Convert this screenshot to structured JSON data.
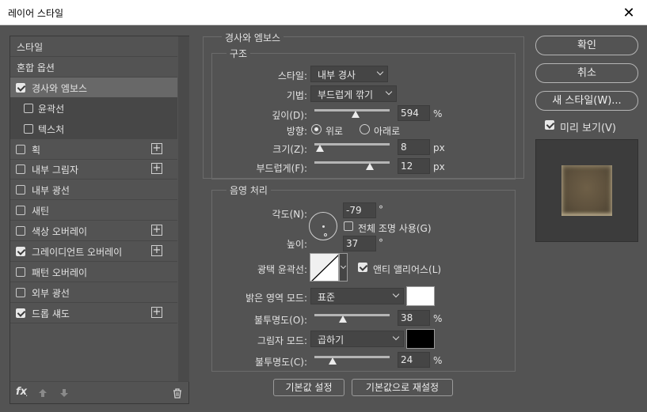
{
  "window": {
    "title": "레이어 스타일",
    "close_glyph": "✕"
  },
  "styles_list": [
    {
      "label": "스타일",
      "checkable": false,
      "checked": false,
      "plus": false,
      "state": "plain"
    },
    {
      "label": "혼합 옵션",
      "checkable": false,
      "checked": false,
      "plus": false,
      "state": "plain"
    },
    {
      "label": "경사와 엠보스",
      "checkable": true,
      "checked": true,
      "plus": false,
      "state": "selected"
    },
    {
      "label": "윤곽선",
      "checkable": true,
      "checked": false,
      "plus": false,
      "state": "sub"
    },
    {
      "label": "텍스처",
      "checkable": true,
      "checked": false,
      "plus": false,
      "state": "sub"
    },
    {
      "label": "획",
      "checkable": true,
      "checked": false,
      "plus": true,
      "state": "normal"
    },
    {
      "label": "내부 그림자",
      "checkable": true,
      "checked": false,
      "plus": true,
      "state": "normal"
    },
    {
      "label": "내부 광선",
      "checkable": true,
      "checked": false,
      "plus": false,
      "state": "normal"
    },
    {
      "label": "새틴",
      "checkable": true,
      "checked": false,
      "plus": false,
      "state": "normal"
    },
    {
      "label": "색상 오버레이",
      "checkable": true,
      "checked": false,
      "plus": true,
      "state": "normal"
    },
    {
      "label": "그레이디언트 오버레이",
      "checkable": true,
      "checked": true,
      "plus": true,
      "state": "normal"
    },
    {
      "label": "패턴 오버레이",
      "checkable": true,
      "checked": false,
      "plus": false,
      "state": "normal"
    },
    {
      "label": "외부 광선",
      "checkable": true,
      "checked": false,
      "plus": false,
      "state": "normal"
    },
    {
      "label": "드롭 섀도",
      "checkable": true,
      "checked": true,
      "plus": true,
      "state": "normal"
    }
  ],
  "footer": {
    "fx_label": "fx",
    "fx_dot": "."
  },
  "bevel": {
    "section_title": "경사와 엠보스",
    "structure_title": "구조",
    "style_label": "스타일:",
    "style_value": "내부 경사",
    "technique_label": "기법:",
    "technique_value": "부드럽게 깎기",
    "depth_label": "깊이(D):",
    "depth_value": "594",
    "depth_unit": "%",
    "depth_pos": 0.55,
    "direction_label": "방향:",
    "direction_up": "위로",
    "direction_down": "아래로",
    "size_label": "크기(Z):",
    "size_value": "8",
    "size_unit": "px",
    "size_pos": 0.07,
    "soften_label": "부드럽게(F):",
    "soften_value": "12",
    "soften_unit": "px",
    "soften_pos": 0.74
  },
  "shading": {
    "title": "음영 처리",
    "angle_label": "각도(N):",
    "angle_value": "-79",
    "angle_unit": "°",
    "global_light_label": "전체 조명 사용(G)",
    "altitude_label": "높이:",
    "altitude_value": "37",
    "altitude_unit": "°",
    "gloss_label": "광택 윤곽선:",
    "antialias_label": "앤티 앨리어스(L)",
    "highlight_label": "밝은 영역 모드:",
    "highlight_mode": "표준",
    "highlight_color": "#ffffff",
    "highlight_opacity_label": "불투명도(O):",
    "highlight_opacity": "38",
    "highlight_opacity_unit": "%",
    "highlight_opacity_pos": 0.38,
    "shadow_label": "그림자 모드:",
    "shadow_mode": "곱하기",
    "shadow_color": "#000000",
    "shadow_opacity_label": "불투명도(C):",
    "shadow_opacity": "24",
    "shadow_opacity_unit": "%",
    "shadow_opacity_pos": 0.24
  },
  "bottom_buttons": {
    "default": "기본값 설정",
    "reset": "기본값으로 재설정"
  },
  "right": {
    "ok": "확인",
    "cancel": "취소",
    "new_style": "새 스타일(W)...",
    "preview_label": "미리 보기(V)"
  }
}
